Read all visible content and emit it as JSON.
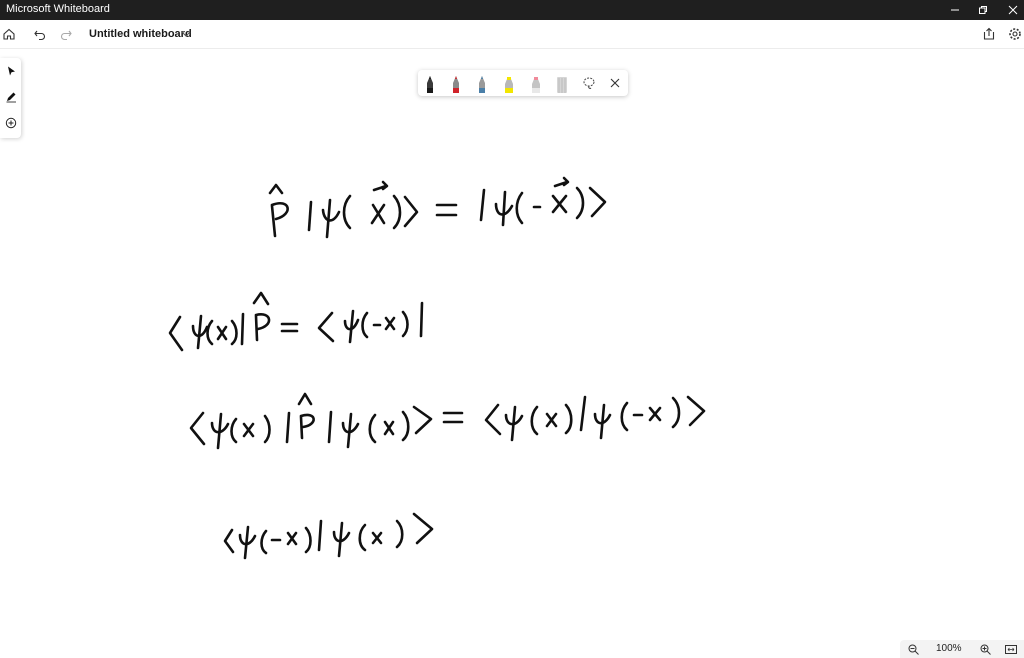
{
  "window": {
    "title": "Microsoft Whiteboard"
  },
  "toolbar": {
    "board_title": "Untitled whiteboard"
  },
  "pen_tray": {
    "pens": [
      {
        "name": "black-pen",
        "color": "#1a1a1a"
      },
      {
        "name": "red-pen",
        "color": "#d0232a"
      },
      {
        "name": "blue-pen",
        "color": "#4a7fa8"
      },
      {
        "name": "yellow-highlighter",
        "color": "#f2e600"
      },
      {
        "name": "pink-highlighter",
        "color": "#f08a9a"
      },
      {
        "name": "eraser",
        "color": "#cfcfcf"
      }
    ]
  },
  "status": {
    "zoom": "100%"
  }
}
